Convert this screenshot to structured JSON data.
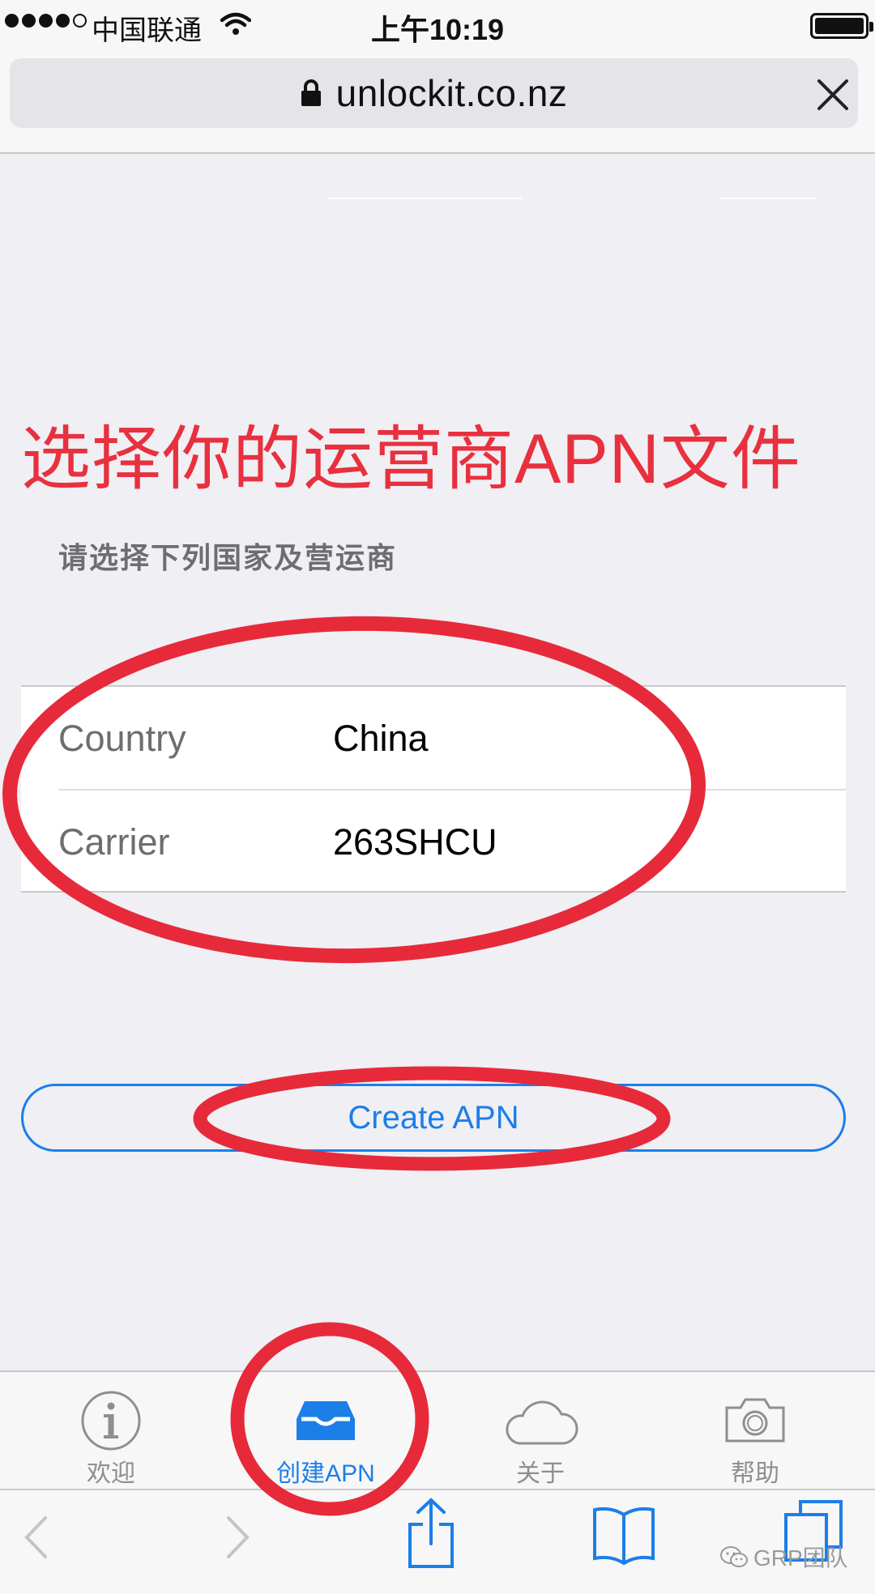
{
  "status_bar": {
    "carrier": "中国联通",
    "time": "上午10:19",
    "signal_bars_filled": 4,
    "signal_bars_total": 5,
    "battery_level": 1.0
  },
  "browser": {
    "url": "unlockit.co.nz",
    "secure": true
  },
  "annotation": {
    "title": "选择你的运营商APN文件",
    "color": "#e8303e"
  },
  "main": {
    "section_header": "请选择下列国家及营运商",
    "form": [
      {
        "label": "Country",
        "value": "China"
      },
      {
        "label": "Carrier",
        "value": "263SHCU"
      }
    ],
    "create_button": "Create APN",
    "accent_color": "#1c7ee8"
  },
  "tab_bar": {
    "tabs": [
      {
        "label": "欢迎",
        "icon": "info-icon",
        "active": false
      },
      {
        "label": "创建APN",
        "icon": "tray-icon",
        "active": true
      },
      {
        "label": "关于",
        "icon": "cloud-icon",
        "active": false
      },
      {
        "label": "帮助",
        "icon": "camera-icon",
        "active": false
      }
    ]
  },
  "toolbar": {
    "buttons": [
      "back-icon",
      "forward-icon",
      "share-icon",
      "bookmarks-icon",
      "tabs-icon"
    ],
    "watermark": "GRP团队"
  }
}
